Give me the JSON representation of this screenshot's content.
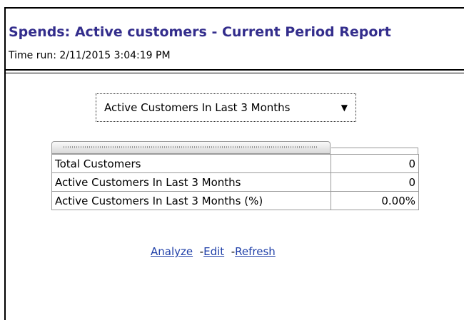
{
  "report": {
    "title": "Spends: Active customers - Current Period Report",
    "time_run": "Time run: 2/11/2015 3:04:19 PM"
  },
  "filter": {
    "selected": "Active Customers In Last 3 Months",
    "caret_icon": "chevron-down-icon"
  },
  "table": {
    "rows": [
      {
        "label": "Total Customers",
        "value": "0"
      },
      {
        "label": "Active Customers In Last 3 Months",
        "value": "0"
      },
      {
        "label": "Active Customers In Last 3 Months (%)",
        "value": "0.00%"
      }
    ]
  },
  "links": {
    "analyze": "Analyze",
    "edit": "Edit",
    "refresh": "Refresh",
    "separator": "-"
  },
  "colors": {
    "title": "#332d8c",
    "link": "#1f3fa8"
  }
}
